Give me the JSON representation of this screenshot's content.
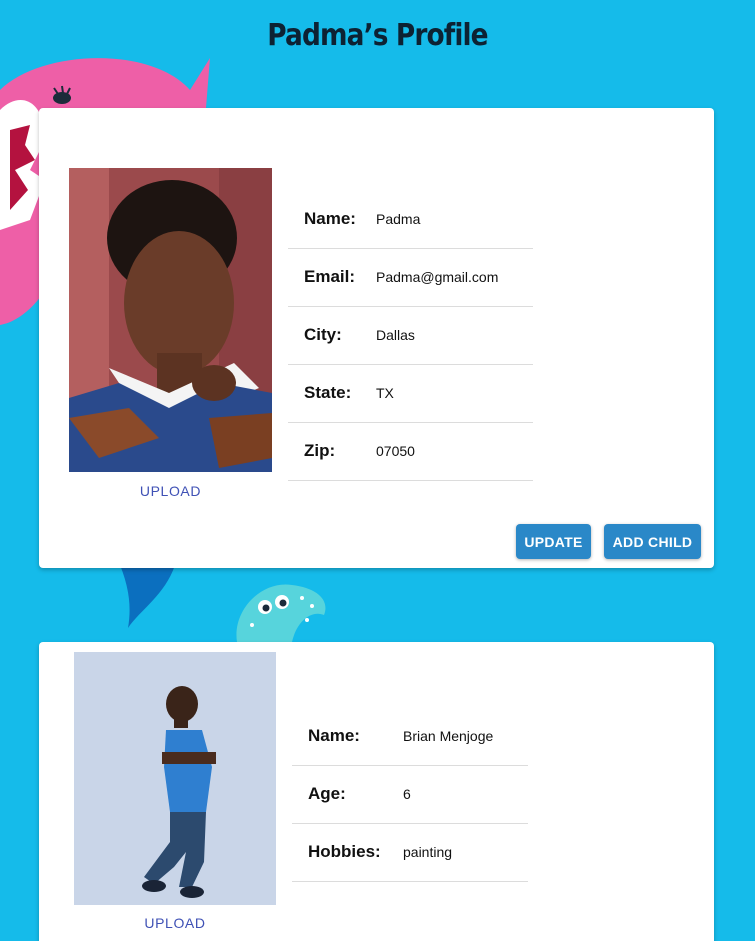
{
  "page": {
    "title": "Padma’s Profile",
    "background_color": "#15bbea",
    "accent_color": "#2a88c8"
  },
  "parent": {
    "photo_icon": "portrait-photo",
    "upload_label": "UPLOAD",
    "fields": [
      {
        "label": "Name:",
        "value": "Padma"
      },
      {
        "label": "Email:",
        "value": "Padma@gmail.com"
      },
      {
        "label": "City:",
        "value": "Dallas"
      },
      {
        "label": "State:",
        "value": "TX"
      },
      {
        "label": "Zip:",
        "value": "07050"
      }
    ],
    "update_label": "UPDATE",
    "add_child_label": "ADD CHILD"
  },
  "child": {
    "photo_icon": "child-photo",
    "upload_label": "UPLOAD",
    "fields": [
      {
        "label": "Name:",
        "value": "Brian Menjoge"
      },
      {
        "label": "Age:",
        "value": "6"
      },
      {
        "label": "Hobbies:",
        "value": "painting"
      }
    ]
  }
}
